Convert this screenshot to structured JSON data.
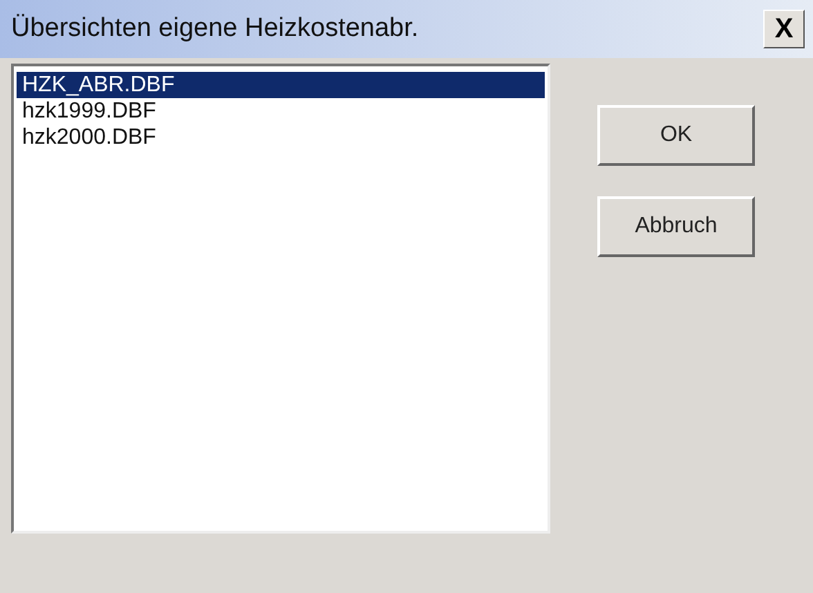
{
  "window": {
    "title": "Übersichten eigene Heizkostenabr.",
    "close": "X"
  },
  "list": {
    "items": [
      {
        "label": "HZK_ABR.DBF",
        "selected": true
      },
      {
        "label": "hzk1999.DBF",
        "selected": false
      },
      {
        "label": "hzk2000.DBF",
        "selected": false
      }
    ]
  },
  "buttons": [
    "OK",
    "Abbruch"
  ]
}
